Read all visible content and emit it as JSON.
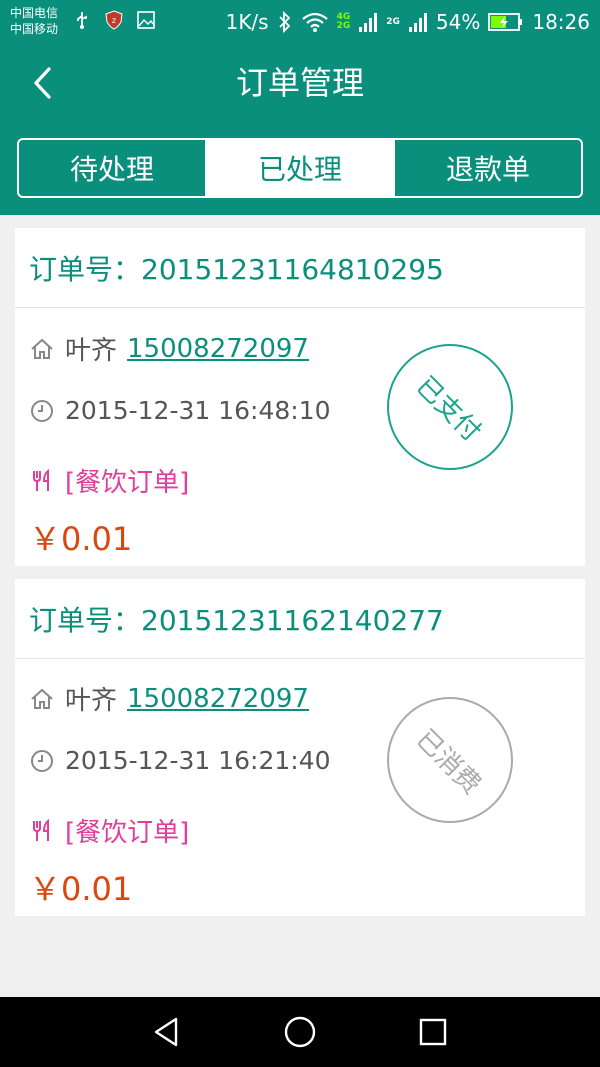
{
  "statusbar": {
    "carrier1": "中国电信",
    "carrier2": "中国移动",
    "net_speed": "1K/s",
    "net_tag_4g": "4G",
    "net_tag_2g_a": "2G",
    "net_tag_2g_b": "2G",
    "battery": "54%",
    "time": "18:26"
  },
  "header": {
    "title": "订单管理",
    "back_icon": "chevron-left-icon",
    "tabs": [
      {
        "label": "待处理",
        "active": false
      },
      {
        "label": "已处理",
        "active": true
      },
      {
        "label": "退款单",
        "active": false
      }
    ]
  },
  "orders": [
    {
      "order_no": "订单号：20151231164810295",
      "name": "叶齐",
      "phone": "15008272097",
      "time": "2015-12-31 16:48:10",
      "type": "[餐饮订单]",
      "price": "￥0.01",
      "stamp": "已支付",
      "stamp_color": "#1aa38f"
    },
    {
      "order_no": "订单号：20151231162140277",
      "name": "叶齐",
      "phone": "15008272097",
      "time": "2015-12-31 16:21:40",
      "type": "[餐饮订单]",
      "price": "￥0.01",
      "stamp": "已消费",
      "stamp_color": "#aaaaaa"
    }
  ],
  "colors": {
    "primary": "#0b8f7d",
    "link": "#0b8f7d",
    "type": "#e23d9a",
    "price": "#d9480f"
  }
}
